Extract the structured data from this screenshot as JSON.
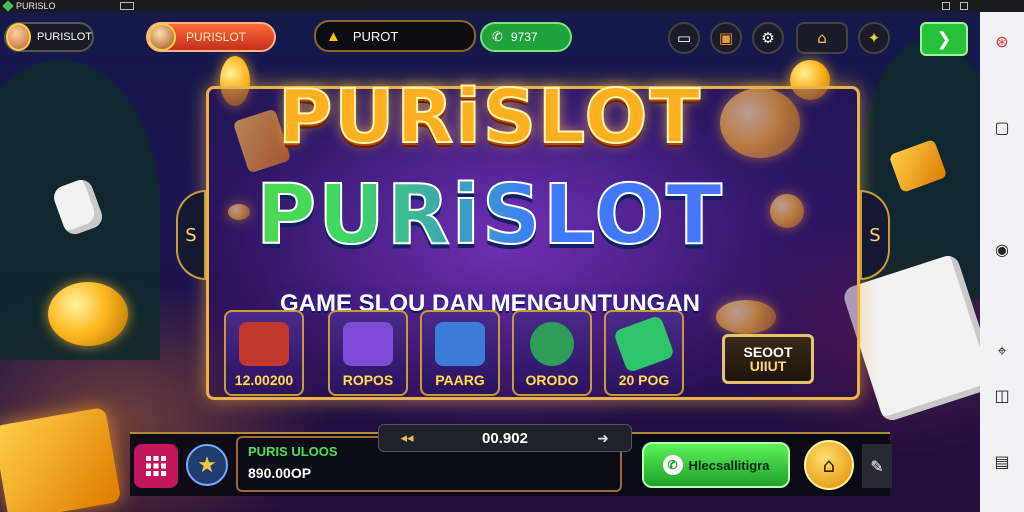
{
  "window": {
    "title": "PURISLO"
  },
  "topbar": {
    "player_name": "PURISLOT",
    "profile_tag": "PURISLOT",
    "alert_text": "PUROT",
    "phone_text": "9737",
    "icons": [
      "monitor-icon",
      "chest-icon",
      "gear-icon",
      "home-icon",
      "gift-icon"
    ],
    "go_arrow": "❯"
  },
  "banner": {
    "logo_line1": "PURiSLOT",
    "logo_line2": "PURiSLOT",
    "tagline": "GAME SLOU DAN MENGUNTUNGAN",
    "left_arrow": "S",
    "right_arrow": "S"
  },
  "tiles": [
    {
      "label": "12.00200",
      "color": "#c0392b"
    },
    {
      "label": "ROPOS",
      "color": "#7d4bd8"
    },
    {
      "label": "PAARG",
      "color": "#3d7bd8"
    },
    {
      "label": "ORODO",
      "color": "#2e9e5a"
    },
    {
      "label": "20 POG",
      "color": "#2ec46a"
    }
  ],
  "sign": {
    "line1": "SEOOT",
    "line2": "UIIUT"
  },
  "bottombar": {
    "balance_title": "PURIS ULOOS",
    "balance_value": "890.00OP",
    "counter_left": "◂◂",
    "counter_value": "00.902",
    "counter_right": "➜",
    "green_button_label": "Hlecsallitigra"
  },
  "colors": {
    "accent_gold": "#e7b24a",
    "accent_green": "#3ec45a",
    "sidebar_bg": "#f2f2f4"
  }
}
